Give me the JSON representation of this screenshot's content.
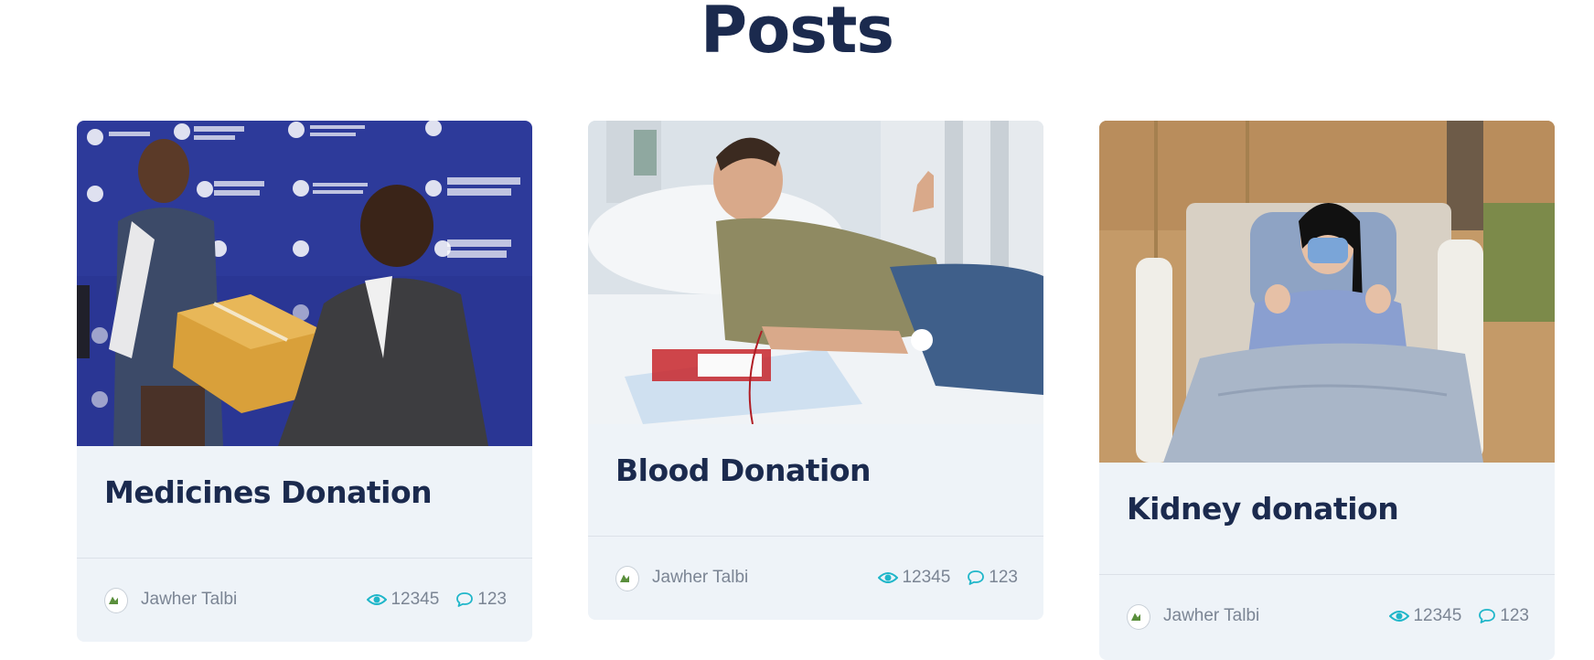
{
  "page": {
    "title": "Posts"
  },
  "posts": [
    {
      "title": "Medicines Donation",
      "author": "Jawher Talbi",
      "views": "12345",
      "comments": "123"
    },
    {
      "title": "Blood Donation",
      "author": "Jawher Talbi",
      "views": "12345",
      "comments": "123"
    },
    {
      "title": "Kidney donation",
      "author": "Jawher Talbi",
      "views": "12345",
      "comments": "123"
    }
  ],
  "colors": {
    "title": "#1b2a4e",
    "card_bg": "#eef3f8",
    "accent": "#1fb6c9",
    "meta_text": "#7b8594"
  },
  "icons": {
    "views": "eye-icon",
    "comments": "comment-icon",
    "avatar": "broken-image-avatar"
  }
}
